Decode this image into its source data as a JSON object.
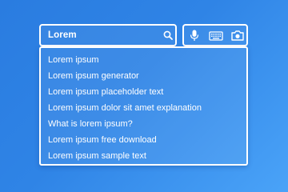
{
  "search": {
    "query": "Lorem",
    "icon": "search-icon"
  },
  "tools": {
    "voice_icon": "microphone-icon",
    "keyboard_icon": "keyboard-icon",
    "camera_icon": "camera-icon"
  },
  "suggestions": [
    "Lorem ipsum",
    "Lorem ipsum generator",
    "Lorem ipsum placeholder text",
    "Lorem ipsum dolor sit amet explanation",
    "What is lorem ipsum?",
    "Lorem ipsum free download",
    "Lorem ipsum sample text"
  ],
  "colors": {
    "background_start": "#2a7ce0",
    "background_end": "#4aa3f8",
    "foreground": "#ffffff"
  }
}
